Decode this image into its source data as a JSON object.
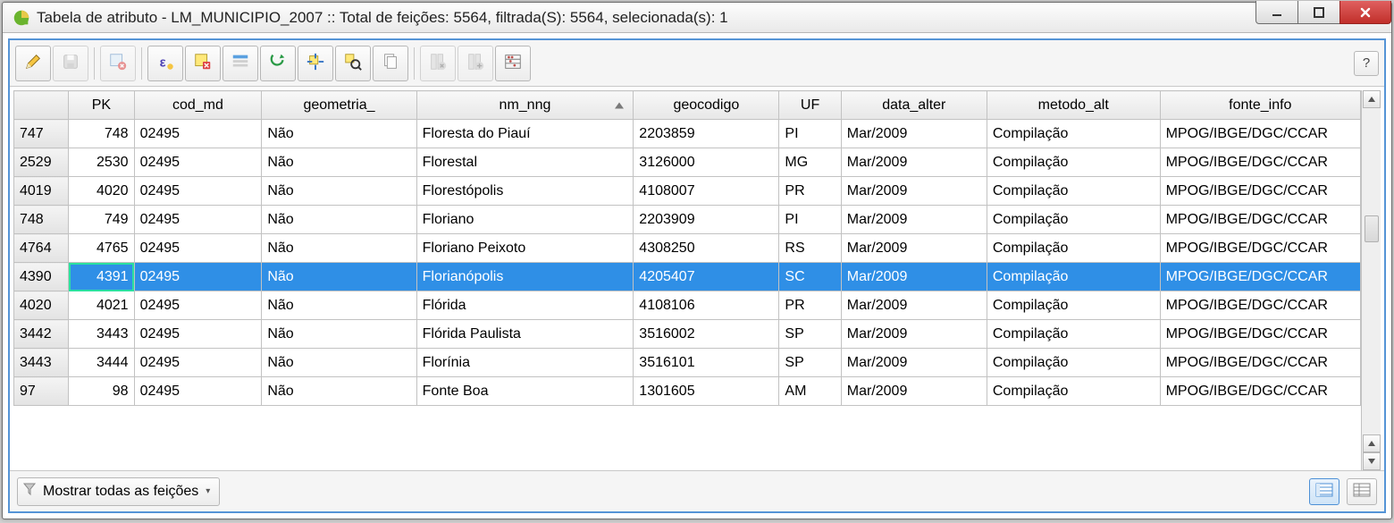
{
  "window": {
    "title": "Tabela de atributo - LM_MUNICIPIO_2007 :: Total de feições: 5564, filtrada(S): 5564, selecionada(s): 1"
  },
  "toolbar": {
    "help_label": "?"
  },
  "columns": {
    "row": "",
    "pk": "PK",
    "cod_md": "cod_md",
    "geometria": "geometria_",
    "nm_nng": "nm_nng",
    "geocodigo": "geocodigo",
    "uf": "UF",
    "data_alter": "data_alter",
    "metodo_alt": "metodo_alt",
    "fonte_info": "fonte_info"
  },
  "rows": [
    {
      "idx": "747",
      "pk": "748",
      "cod_md": "02495",
      "geometria": "Não",
      "nm_nng": "Floresta do Piauí",
      "geocodigo": "2203859",
      "uf": "PI",
      "data_alter": "Mar/2009",
      "metodo_alt": "Compilação",
      "fonte_info": "MPOG/IBGE/DGC/CCAR",
      "selected": false
    },
    {
      "idx": "2529",
      "pk": "2530",
      "cod_md": "02495",
      "geometria": "Não",
      "nm_nng": "Florestal",
      "geocodigo": "3126000",
      "uf": "MG",
      "data_alter": "Mar/2009",
      "metodo_alt": "Compilação",
      "fonte_info": "MPOG/IBGE/DGC/CCAR",
      "selected": false
    },
    {
      "idx": "4019",
      "pk": "4020",
      "cod_md": "02495",
      "geometria": "Não",
      "nm_nng": "Florestópolis",
      "geocodigo": "4108007",
      "uf": "PR",
      "data_alter": "Mar/2009",
      "metodo_alt": "Compilação",
      "fonte_info": "MPOG/IBGE/DGC/CCAR",
      "selected": false
    },
    {
      "idx": "748",
      "pk": "749",
      "cod_md": "02495",
      "geometria": "Não",
      "nm_nng": "Floriano",
      "geocodigo": "2203909",
      "uf": "PI",
      "data_alter": "Mar/2009",
      "metodo_alt": "Compilação",
      "fonte_info": "MPOG/IBGE/DGC/CCAR",
      "selected": false
    },
    {
      "idx": "4764",
      "pk": "4765",
      "cod_md": "02495",
      "geometria": "Não",
      "nm_nng": "Floriano Peixoto",
      "geocodigo": "4308250",
      "uf": "RS",
      "data_alter": "Mar/2009",
      "metodo_alt": "Compilação",
      "fonte_info": "MPOG/IBGE/DGC/CCAR",
      "selected": false
    },
    {
      "idx": "4390",
      "pk": "4391",
      "cod_md": "02495",
      "geometria": "Não",
      "nm_nng": "Florianópolis",
      "geocodigo": "4205407",
      "uf": "SC",
      "data_alter": "Mar/2009",
      "metodo_alt": "Compilação",
      "fonte_info": "MPOG/IBGE/DGC/CCAR",
      "selected": true
    },
    {
      "idx": "4020",
      "pk": "4021",
      "cod_md": "02495",
      "geometria": "Não",
      "nm_nng": "Flórida",
      "geocodigo": "4108106",
      "uf": "PR",
      "data_alter": "Mar/2009",
      "metodo_alt": "Compilação",
      "fonte_info": "MPOG/IBGE/DGC/CCAR",
      "selected": false
    },
    {
      "idx": "3442",
      "pk": "3443",
      "cod_md": "02495",
      "geometria": "Não",
      "nm_nng": "Flórida Paulista",
      "geocodigo": "3516002",
      "uf": "SP",
      "data_alter": "Mar/2009",
      "metodo_alt": "Compilação",
      "fonte_info": "MPOG/IBGE/DGC/CCAR",
      "selected": false
    },
    {
      "idx": "3443",
      "pk": "3444",
      "cod_md": "02495",
      "geometria": "Não",
      "nm_nng": "Florínia",
      "geocodigo": "3516101",
      "uf": "SP",
      "data_alter": "Mar/2009",
      "metodo_alt": "Compilação",
      "fonte_info": "MPOG/IBGE/DGC/CCAR",
      "selected": false
    },
    {
      "idx": "97",
      "pk": "98",
      "cod_md": "02495",
      "geometria": "Não",
      "nm_nng": "Fonte Boa",
      "geocodigo": "1301605",
      "uf": "AM",
      "data_alter": "Mar/2009",
      "metodo_alt": "Compilação",
      "fonte_info": "MPOG/IBGE/DGC/CCAR",
      "selected": false
    }
  ],
  "footer": {
    "filter_label": "Mostrar todas as feições"
  }
}
